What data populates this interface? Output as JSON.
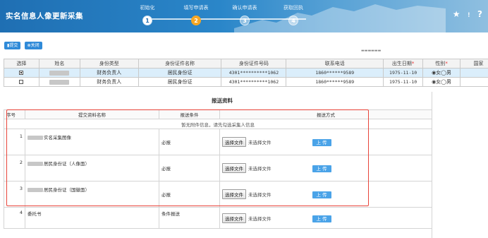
{
  "app": {
    "title": "实名信息人像更新采集"
  },
  "steps": [
    {
      "label": "初始化",
      "num": "1",
      "state": "done"
    },
    {
      "label": "填写申请表",
      "num": "2",
      "state": "active"
    },
    {
      "label": "确认申请表",
      "num": "3",
      "state": "todo"
    },
    {
      "label": "获取回执",
      "num": "4",
      "state": "todo"
    }
  ],
  "header_icons": {
    "star": "★",
    "info": "!",
    "help": "?"
  },
  "toolbar": {
    "submit": "提交",
    "close": "关闭"
  },
  "person_table": {
    "columns": [
      "选择",
      "姓名",
      "身份类型",
      "身份证件名称",
      "身份证件号码",
      "联系电话",
      "出生日期",
      "性别",
      "国家"
    ],
    "rows": [
      {
        "selected": true,
        "identity_type": "财务负责人",
        "doc_name": "居民身份证",
        "doc_no": "4301**********1062",
        "phone": "1860******9589",
        "birth": "1975-11-10",
        "gender": "◉女◯男"
      },
      {
        "selected": false,
        "identity_type": "财务负责人",
        "doc_name": "居民身份证",
        "doc_no": "4301**********1062",
        "phone": "1860******9589",
        "birth": "1975-11-10",
        "gender": "◉女◯男"
      }
    ]
  },
  "materials": {
    "section_title": "报送资料",
    "columns": [
      "序号",
      "提交资料名称",
      "报送条件",
      "报送方式"
    ],
    "notice": "暂无附件信息，请先勾选采集人信息",
    "file_button": "选择文件",
    "no_file": "未选择文件",
    "upload": "上 传",
    "items": [
      {
        "no": "1",
        "name": "实名采集图像",
        "condition": "必报"
      },
      {
        "no": "2",
        "name": "居民身份证（人像面）",
        "condition": "必报"
      },
      {
        "no": "3",
        "name": "居民身份证（国徽面）",
        "condition": "必报"
      },
      {
        "no": "4",
        "name": "委托书",
        "condition": "条件报送"
      }
    ]
  },
  "colors": {
    "header": "#1f6fb3",
    "active_step": "#f5a623",
    "upload": "#4aa3e8",
    "highlight_box": "#e8443a",
    "selected_row": "#dbeefb"
  }
}
